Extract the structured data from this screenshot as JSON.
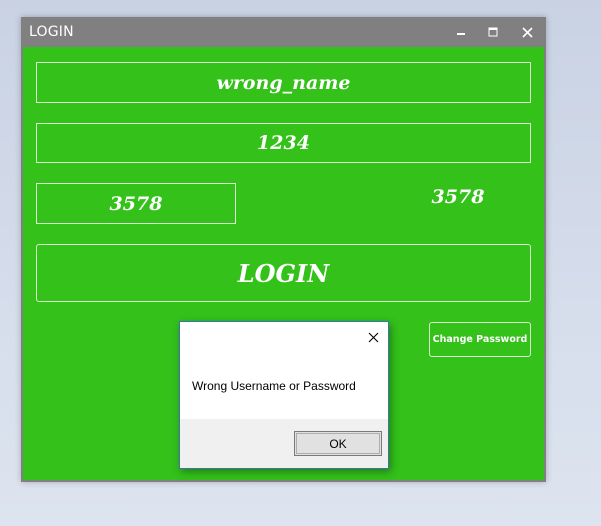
{
  "window": {
    "title": "LOGIN",
    "controls": {
      "minimize_icon": "minimize-icon",
      "maximize_icon": "maximize-icon",
      "close_icon": "close-icon"
    }
  },
  "form": {
    "username_value": "wrong_name",
    "password_value": "1234",
    "captcha_input_value": "3578",
    "captcha_label": "3578",
    "login_label": "LOGIN",
    "change_password_label": "Change Password"
  },
  "dialog": {
    "message": "Wrong Username or Password",
    "ok_label": "OK",
    "close_icon": "close-icon"
  },
  "colors": {
    "form_background": "#33c11a",
    "titlebar": "#808080",
    "text": "#ffffff",
    "desktop": "#d6deec"
  }
}
